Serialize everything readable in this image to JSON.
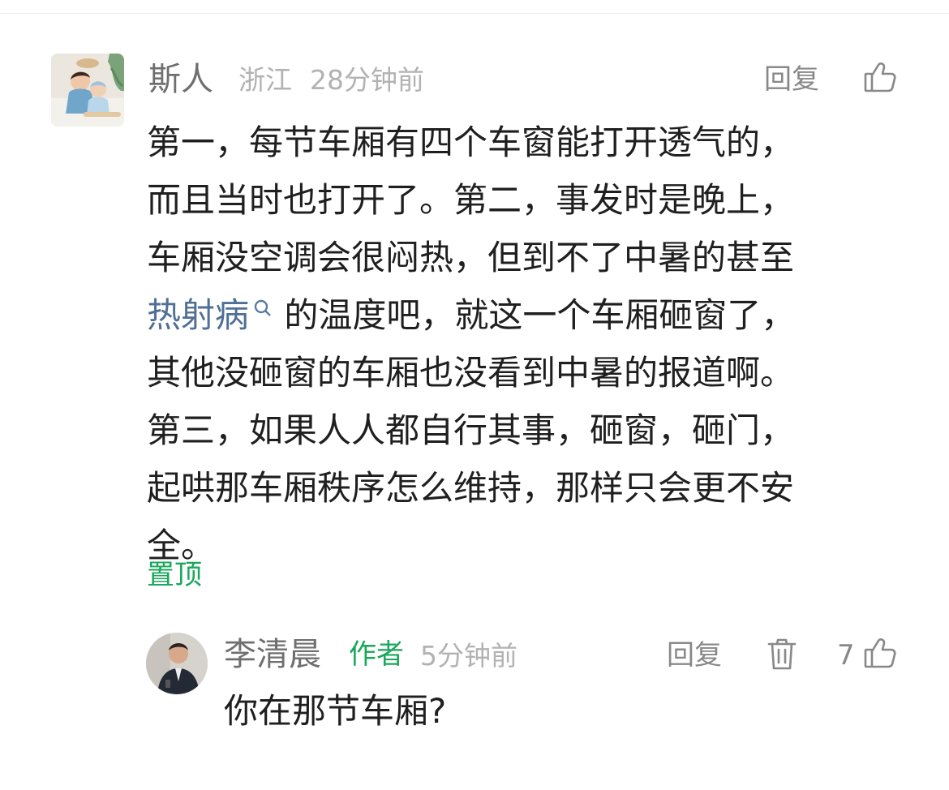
{
  "comment": {
    "user": {
      "name": "斯人",
      "location": "浙江",
      "time": "28分钟前"
    },
    "reply_label": "回复",
    "like_icon": "thumbs-up-icon",
    "body_lines": [
      "第一，每节车厢有四个车窗能打开透气的，",
      "而且当时也打开了。第二，事发时是晚上，",
      "车厢没空调会很闷热，但到不了中暑的甚至"
    ],
    "keyword": "热射病",
    "keyword_icon": "search-icon",
    "keyword_after": "的温度吧，就这一个车厢砸窗了，",
    "body_lines_after": [
      "其他没砸窗的车厢也没看到中暑的报道啊。",
      "第三，如果人人都自行其事，砸窗，砸门，",
      "起哄那车厢秩序怎么维持，那样只会更不安",
      "全。"
    ],
    "pin_label": "置顶"
  },
  "reply": {
    "user": {
      "name": "李清晨",
      "badge": "作者",
      "time": "5分钟前"
    },
    "reply_label": "回复",
    "delete_icon": "trash-icon",
    "like_count": "7",
    "like_icon": "thumbs-up-icon",
    "text": "你在那节车厢?"
  },
  "colors": {
    "accent_green": "#17a85a",
    "keyword_blue": "#4f6f96",
    "text_main": "#1f1f1f",
    "text_meta": "#b2b2b2"
  }
}
